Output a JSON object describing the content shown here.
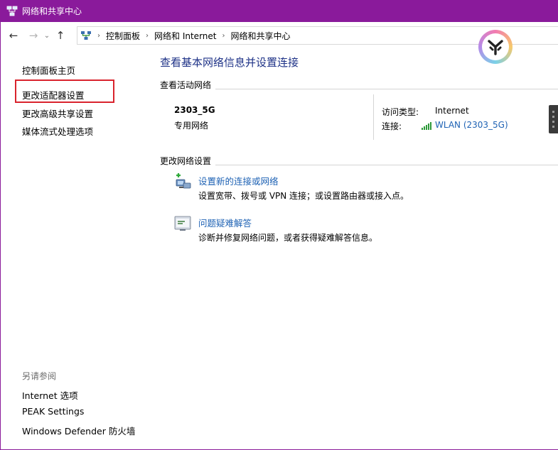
{
  "window": {
    "title": "网络和共享中心"
  },
  "nav": {
    "breadcrumbs": [
      "控制面板",
      "网络和 Internet",
      "网络和共享中心"
    ]
  },
  "sidebar": {
    "items": [
      {
        "label": "控制面板主页"
      },
      {
        "label": "更改适配器设置"
      },
      {
        "label": "更改高级共享设置"
      },
      {
        "label": "媒体流式处理选项"
      }
    ],
    "see_also": {
      "title": "另请参阅",
      "items": [
        {
          "label": "Internet 选项"
        },
        {
          "label": "PEAK Settings"
        },
        {
          "label": "Windows Defender 防火墙"
        }
      ]
    }
  },
  "main": {
    "heading": "查看基本网络信息并设置连接",
    "active_networks": {
      "label": "查看活动网络",
      "network_name": "2303_5G",
      "network_type": "专用网络",
      "access_type_label": "访问类型:",
      "access_type_value": "Internet",
      "connection_label": "连接:",
      "connection_value": "WLAN (2303_5G)"
    },
    "change_settings": {
      "label": "更改网络设置",
      "tasks": [
        {
          "title": "设置新的连接或网络",
          "description": "设置宽带、拨号或 VPN 连接；或设置路由器或接入点。",
          "icon": "network-setup-icon"
        },
        {
          "title": "问题疑难解答",
          "description": "诊断并修复网络问题，或者获得疑难解答信息。",
          "icon": "troubleshoot-icon"
        }
      ]
    }
  },
  "colors": {
    "titlebar": "#8a1a9b",
    "heading": "#1e3287",
    "link": "#1e62b4",
    "highlight_box": "#d9232d"
  }
}
